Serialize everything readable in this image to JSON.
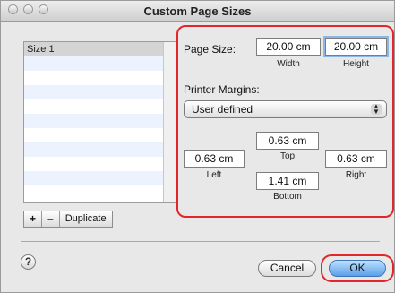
{
  "window": {
    "title": "Custom Page Sizes"
  },
  "list": {
    "items": [
      "Size 1"
    ]
  },
  "list_buttons": {
    "add": "+",
    "remove": "–",
    "duplicate": "Duplicate"
  },
  "page_size": {
    "label": "Page Size:",
    "width_value": "20.00 cm",
    "height_value": "20.00 cm",
    "width_label": "Width",
    "height_label": "Height"
  },
  "margins": {
    "label": "Printer Margins:",
    "mode": "User defined",
    "top_value": "0.63 cm",
    "left_value": "0.63 cm",
    "right_value": "0.63 cm",
    "bottom_value": "1.41 cm",
    "top_label": "Top",
    "left_label": "Left",
    "right_label": "Right",
    "bottom_label": "Bottom"
  },
  "footer": {
    "help": "?",
    "cancel": "Cancel",
    "ok": "OK"
  },
  "colors": {
    "highlight": "#e2262b",
    "default_button": "#5aa0e8"
  }
}
